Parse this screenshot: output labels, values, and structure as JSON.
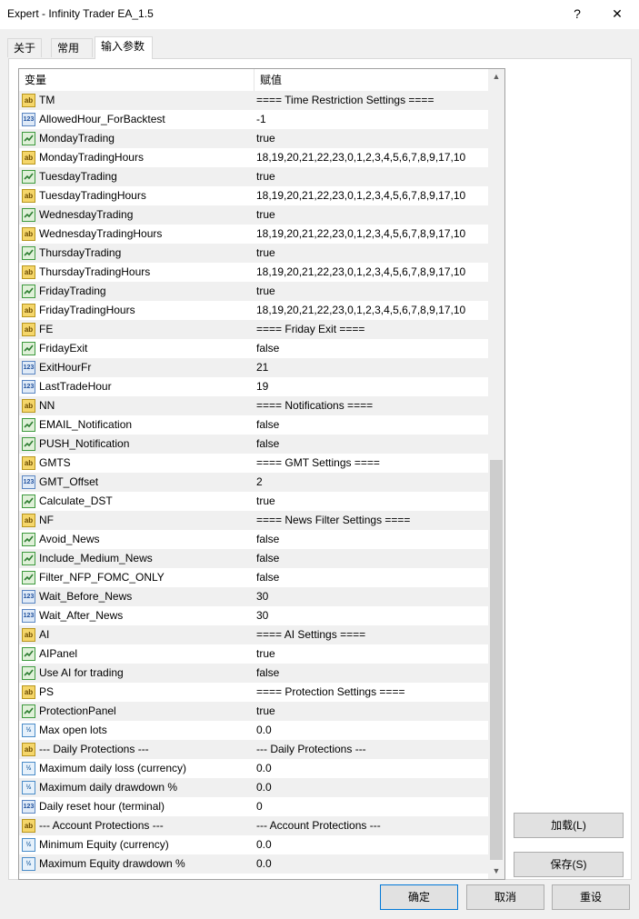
{
  "window": {
    "title": "Expert - Infinity Trader EA_1.5",
    "help_label": "?",
    "close_label": "✕"
  },
  "tabs": [
    {
      "label": "关于"
    },
    {
      "label": "常用"
    },
    {
      "label": "输入参数"
    }
  ],
  "grid": {
    "header_variable": "变量",
    "header_value": "赋值",
    "rows": [
      {
        "type": "ab",
        "name": "TM",
        "value": "==== Time Restriction Settings ===="
      },
      {
        "type": "num",
        "name": "AllowedHour_ForBacktest",
        "value": "-1"
      },
      {
        "type": "bool",
        "name": "MondayTrading",
        "value": "true"
      },
      {
        "type": "ab",
        "name": "MondayTradingHours",
        "value": "18,19,20,21,22,23,0,1,2,3,4,5,6,7,8,9,17,10"
      },
      {
        "type": "bool",
        "name": "TuesdayTrading",
        "value": "true"
      },
      {
        "type": "ab",
        "name": "TuesdayTradingHours",
        "value": "18,19,20,21,22,23,0,1,2,3,4,5,6,7,8,9,17,10"
      },
      {
        "type": "bool",
        "name": "WednesdayTrading",
        "value": "true"
      },
      {
        "type": "ab",
        "name": "WednesdayTradingHours",
        "value": "18,19,20,21,22,23,0,1,2,3,4,5,6,7,8,9,17,10"
      },
      {
        "type": "bool",
        "name": "ThursdayTrading",
        "value": "true"
      },
      {
        "type": "ab",
        "name": "ThursdayTradingHours",
        "value": "18,19,20,21,22,23,0,1,2,3,4,5,6,7,8,9,17,10"
      },
      {
        "type": "bool",
        "name": "FridayTrading",
        "value": "true"
      },
      {
        "type": "ab",
        "name": "FridayTradingHours",
        "value": "18,19,20,21,22,23,0,1,2,3,4,5,6,7,8,9,17,10"
      },
      {
        "type": "ab",
        "name": "FE",
        "value": "==== Friday Exit ===="
      },
      {
        "type": "bool",
        "name": "FridayExit",
        "value": "false"
      },
      {
        "type": "num",
        "name": "ExitHourFr",
        "value": "21"
      },
      {
        "type": "num",
        "name": "LastTradeHour",
        "value": "19"
      },
      {
        "type": "ab",
        "name": "NN",
        "value": "==== Notifications ===="
      },
      {
        "type": "bool",
        "name": "EMAIL_Notification",
        "value": "false"
      },
      {
        "type": "bool",
        "name": "PUSH_Notification",
        "value": "false"
      },
      {
        "type": "ab",
        "name": "GMTS",
        "value": "==== GMT Settings ===="
      },
      {
        "type": "num",
        "name": "GMT_Offset",
        "value": "2"
      },
      {
        "type": "bool",
        "name": "Calculate_DST",
        "value": "true"
      },
      {
        "type": "ab",
        "name": "NF",
        "value": "==== News Filter Settings ===="
      },
      {
        "type": "bool",
        "name": "Avoid_News",
        "value": "false"
      },
      {
        "type": "bool",
        "name": "Include_Medium_News",
        "value": "false"
      },
      {
        "type": "bool",
        "name": "Filter_NFP_FOMC_ONLY",
        "value": "false"
      },
      {
        "type": "num",
        "name": "Wait_Before_News",
        "value": "30"
      },
      {
        "type": "num",
        "name": "Wait_After_News",
        "value": "30"
      },
      {
        "type": "ab",
        "name": "AI",
        "value": "==== AI Settings ===="
      },
      {
        "type": "bool",
        "name": "AIPanel",
        "value": "true"
      },
      {
        "type": "bool",
        "name": "Use AI for trading",
        "value": "false"
      },
      {
        "type": "ab",
        "name": "PS",
        "value": "==== Protection Settings ===="
      },
      {
        "type": "bool",
        "name": "ProtectionPanel",
        "value": "true"
      },
      {
        "type": "dbl",
        "name": "Max open lots",
        "value": "0.0"
      },
      {
        "type": "ab",
        "name": "--- Daily Protections ---",
        "value": "--- Daily Protections ---"
      },
      {
        "type": "dbl",
        "name": "Maximum daily loss (currency)",
        "value": "0.0"
      },
      {
        "type": "dbl",
        "name": "Maximum daily drawdown %",
        "value": "0.0"
      },
      {
        "type": "num",
        "name": "Daily reset hour (terminal)",
        "value": "0"
      },
      {
        "type": "ab",
        "name": "--- Account Protections ---",
        "value": "--- Account Protections ---"
      },
      {
        "type": "dbl",
        "name": "Minimum Equity (currency)",
        "value": "0.0"
      },
      {
        "type": "dbl",
        "name": "Maximum Equity drawdown %",
        "value": "0.0"
      }
    ],
    "icon_text": {
      "ab": "ab",
      "num": "123",
      "dbl": "½"
    }
  },
  "buttons": {
    "load": "加载(L)",
    "save": "保存(S)",
    "ok": "确定",
    "cancel": "取消",
    "reset": "重设"
  },
  "colors": {
    "alt_row": "#f0f0f0",
    "default_button_border": "#0078d7"
  }
}
